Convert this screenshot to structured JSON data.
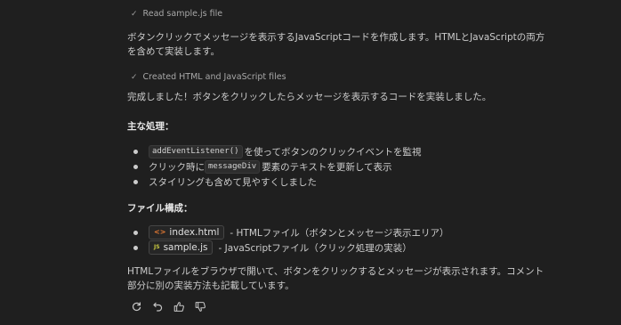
{
  "steps": {
    "read": "Read sample.js file",
    "created": "Created HTML and JavaScript files"
  },
  "intro_text": "ボタンクリックでメッセージを表示するJavaScriptコードを作成します。HTMLとJavaScriptの両方を含めて実装します。",
  "done_text": "完成しました！ボタンをクリックしたらメッセージを表示するコードを実装しました。",
  "main_processing": {
    "heading": "主な処理：",
    "items": [
      {
        "code": "addEventListener()",
        "text": "を使ってボタンのクリックイベントを監視"
      },
      {
        "prefix": "クリック時に",
        "code": "messageDiv",
        "text": "要素のテキストを更新して表示"
      },
      {
        "text": "スタイリングも含めて見やすくしました"
      }
    ]
  },
  "file_structure": {
    "heading": "ファイル構成：",
    "files": [
      {
        "name": "index.html",
        "icon": "html-file-icon",
        "desc": "- HTMLファイル（ボタンとメッセージ表示エリア）"
      },
      {
        "name": "sample.js",
        "icon": "js-file-icon",
        "desc": "- JavaScriptファイル（クリック処理の実装）"
      }
    ]
  },
  "closing_text": "HTMLファイルをブラウザで開いて、ボタンをクリックするとメッセージが表示されます。コメント部分に別の実装方法も記載しています。",
  "actions": [
    "retry-icon",
    "undo-icon",
    "thumbs-up-icon",
    "thumbs-down-icon"
  ],
  "colors": {
    "background": "#1f1f1f",
    "text": "#cccccc",
    "muted": "#a8a8a8",
    "html_icon": "#e37933",
    "js_icon": "#cbcb41"
  }
}
